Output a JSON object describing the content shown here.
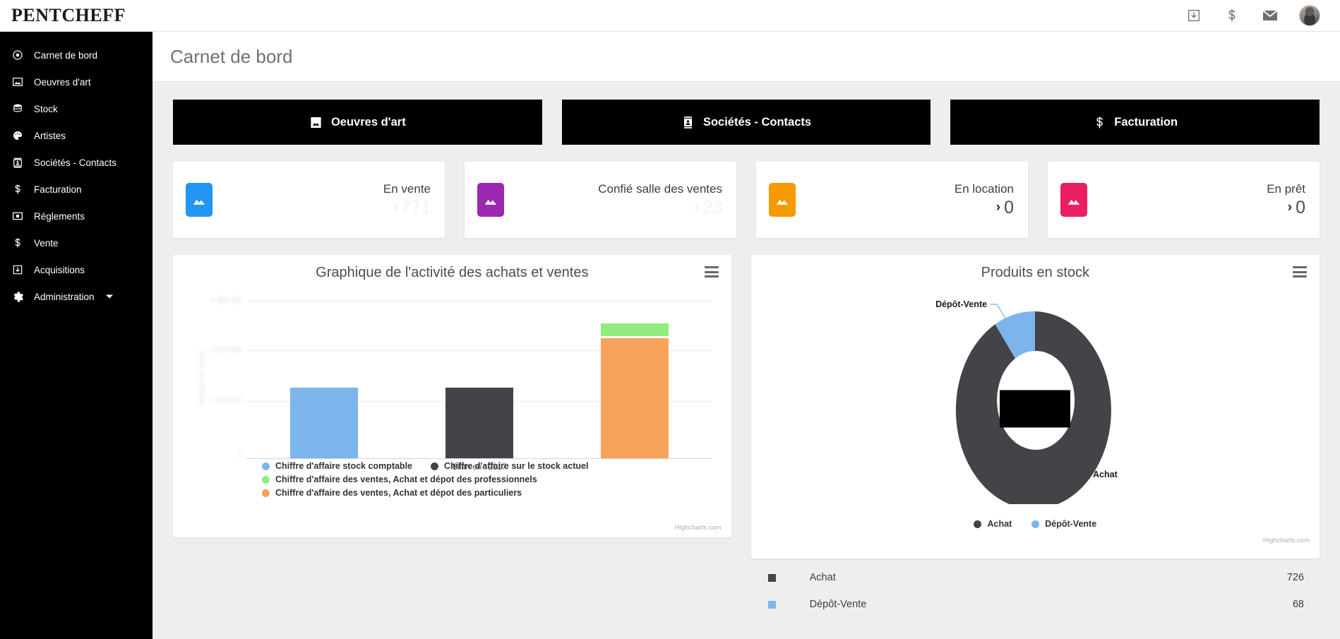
{
  "brand": "PENTCHEFF",
  "header": {
    "icons": [
      {
        "name": "acquisitions-icon",
        "glyph": "download-box"
      },
      {
        "name": "dollar-icon",
        "glyph": "dollar"
      },
      {
        "name": "mail-icon",
        "glyph": "envelope"
      }
    ],
    "avatar_alt": "user-avatar"
  },
  "sidebar": {
    "items": [
      {
        "label": "Carnet de bord",
        "icon": "target-icon",
        "active": true
      },
      {
        "label": "Oeuvres d'art",
        "icon": "picture-icon",
        "active": false
      },
      {
        "label": "Stock",
        "icon": "database-icon",
        "active": false
      },
      {
        "label": "Artistes",
        "icon": "palette-icon",
        "active": false
      },
      {
        "label": "Sociétés - Contacts",
        "icon": "contact-card-icon",
        "active": false
      },
      {
        "label": "Facturation",
        "icon": "dollar-icon",
        "active": false
      },
      {
        "label": "Réglements",
        "icon": "money-box-icon",
        "active": false
      },
      {
        "label": "Vente",
        "icon": "dollar-icon",
        "active": false
      },
      {
        "label": "Acquisitions",
        "icon": "download-box-icon",
        "active": false
      },
      {
        "label": "Administration",
        "icon": "gear-icon",
        "active": false,
        "has_caret": true
      }
    ]
  },
  "page": {
    "title": "Carnet de bord"
  },
  "actions": [
    {
      "label": "Oeuvres d'art",
      "icon": "picture-icon"
    },
    {
      "label": "Sociétés - Contacts",
      "icon": "contact-card-icon"
    },
    {
      "label": "Facturation",
      "icon": "dollar-icon"
    }
  ],
  "stats": [
    {
      "label": "En vente",
      "value": "771",
      "chevron": "›",
      "color": "#2196f3",
      "faded": true
    },
    {
      "label": "Confié salle des ventes",
      "value": "23",
      "chevron": "›",
      "color": "#9c27b0",
      "faded": true
    },
    {
      "label": "En location",
      "value": "0",
      "chevron": "›",
      "color": "#f59b00",
      "faded": false
    },
    {
      "label": "En prêt",
      "value": "0",
      "chevron": "›",
      "color": "#ea1e63",
      "faded": false
    }
  ],
  "credits": {
    "highcharts": "Highcharts.com"
  },
  "chart_data": [
    {
      "type": "bar",
      "title": "Graphique de l'activité des achats et ventes",
      "xlabel": "Bilan en : 2017",
      "ylabel": "",
      "categories": [
        "Chiffre d'affaire stock comptable",
        "Chiffre d'affaire sur le stock actuel",
        "Chiffre d'affaire des ventes"
      ],
      "y_ticks": [
        "",
        "",
        "",
        ""
      ],
      "y_ticks_redacted": true,
      "grid": true,
      "legend_position": "bottom",
      "series": [
        {
          "name": "Chiffre d'affaire stock comptable",
          "color": "#7cb5ec",
          "values": [
            43,
            0,
            0
          ]
        },
        {
          "name": "Chiffre d'affaire sur le stock actuel",
          "color": "#434348",
          "values": [
            0,
            43,
            0
          ]
        },
        {
          "name": "Chiffre d'affaire des ventes, Achat et dépot des professionnels",
          "color": "#90ed7d",
          "values": [
            0,
            0,
            6
          ]
        },
        {
          "name": "Chiffre d'affaire des ventes, Achat et dépot des particuliers",
          "color": "#f7a35c",
          "values": [
            0,
            0,
            82
          ]
        }
      ],
      "legend": [
        "Chiffre d'affaire stock comptable",
        "Chiffre d'affaire sur le stock actuel",
        "Chiffre d'affaire des ventes, Achat et dépot des professionnels",
        "Chiffre d'affaire des ventes, Achat et dépot des particuliers"
      ]
    },
    {
      "type": "pie",
      "title": "Produits en stock",
      "donut": true,
      "labels": [
        "Achat",
        "Dépôt-Vente"
      ],
      "values": [
        726,
        68
      ],
      "colors": [
        "#434348",
        "#7cb5ec"
      ],
      "callouts": [
        "Dépôt-Vente",
        "Achat"
      ],
      "legend": [
        "Achat",
        "Dépôt-Vente"
      ],
      "legend_position": "bottom",
      "center_label_redacted": true
    }
  ],
  "stock_table": {
    "rows": [
      {
        "name": "Achat",
        "value": "726",
        "color": "#434348"
      },
      {
        "name": "Dépôt-Vente",
        "value": "68",
        "color": "#7cb5ec"
      }
    ]
  }
}
